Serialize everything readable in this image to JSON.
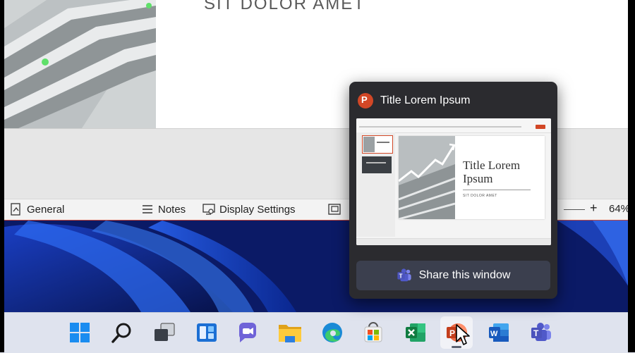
{
  "slide": {
    "heading": "SIT DOLOR AMET"
  },
  "statusbar": {
    "general_label": "General",
    "notes_label": "Notes",
    "display_settings_label": "Display Settings",
    "zoom_plus": "+",
    "zoom_value": "64%"
  },
  "flyout": {
    "app_initial": "P",
    "window_title": "Title Lorem Ipsum",
    "preview": {
      "slide_title": "Title Lorem Ipsum",
      "slide_subtitle": "SIT DOLOR AMET"
    },
    "share_label": "Share this window"
  },
  "taskbar": {
    "items": [
      {
        "name": "start",
        "icon": "windows-icon"
      },
      {
        "name": "search",
        "icon": "search-icon"
      },
      {
        "name": "task-view",
        "icon": "task-view-icon"
      },
      {
        "name": "widgets",
        "icon": "widgets-icon"
      },
      {
        "name": "chat",
        "icon": "teams-chat-icon"
      },
      {
        "name": "file-explorer",
        "icon": "folder-icon"
      },
      {
        "name": "edge",
        "icon": "edge-icon"
      },
      {
        "name": "store",
        "icon": "store-icon"
      },
      {
        "name": "excel",
        "icon": "excel-icon"
      },
      {
        "name": "powerpoint",
        "icon": "powerpoint-icon",
        "active": true
      },
      {
        "name": "word",
        "icon": "word-icon"
      },
      {
        "name": "teams",
        "icon": "teams-icon"
      }
    ]
  },
  "colors": {
    "powerpoint": "#d24726",
    "excel": "#1d6f42",
    "word": "#2b579a",
    "teams": "#5b5fc7",
    "flyout_bg": "#2b2b2f",
    "statusbar_accent": "#c4463a"
  }
}
